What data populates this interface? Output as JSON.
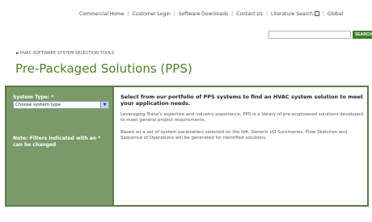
{
  "topnav": {
    "items": [
      "Commercial Home",
      "Customer Login",
      "Software Downloads",
      "Contact Us",
      "Literature Search",
      "Global"
    ],
    "external_icon": "external-link-icon"
  },
  "search": {
    "value": "",
    "button_label": "SEARCH"
  },
  "breadcrumb": {
    "arrow_icon": "arrow-right-icon",
    "text": "HVAC SOFTWARE SYSTEM SELECTION TOOLS"
  },
  "page": {
    "title": "Pre-Packaged Solutions (PPS)"
  },
  "sidebar": {
    "filter_label": "System Type: *",
    "select": {
      "selected": "Choose system type",
      "options": [
        "Choose system type"
      ]
    },
    "note": "Note: Filters indicated with an * can be changed"
  },
  "content": {
    "heading": "Select from our portfolio of PPS systems to find an HVAC system solution to meet your application needs.",
    "paragraph1": "Leveraging Trane's expertise and industry experience, PPS is a library of pre-engineered solutions developed to meet general project requirements.",
    "paragraph2": "Based on a set of system parameters selected on the left, Generic I/O Summaries, Flow Sketches and Sequence of Operations will be generated for identified solutions."
  },
  "colors": {
    "panel_border": "#5d7a4c",
    "sidebar": "#7a9a68",
    "title": "#4f7f27",
    "search_button": "#3f7d2b"
  }
}
